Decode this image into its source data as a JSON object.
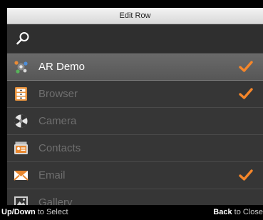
{
  "dialog": {
    "title": "Edit Row"
  },
  "search": {
    "icon": "search-icon"
  },
  "apps": [
    {
      "label": "AR Demo",
      "icon": "ar-demo-icon",
      "checked": true,
      "selected": true
    },
    {
      "label": "Browser",
      "icon": "browser-icon",
      "checked": true,
      "selected": false
    },
    {
      "label": "Camera",
      "icon": "camera-icon",
      "checked": false,
      "selected": false
    },
    {
      "label": "Contacts",
      "icon": "contacts-icon",
      "checked": false,
      "selected": false
    },
    {
      "label": "Email",
      "icon": "email-icon",
      "checked": true,
      "selected": false
    },
    {
      "label": "Gallery",
      "icon": "gallery-icon",
      "checked": false,
      "selected": false
    }
  ],
  "footer": {
    "select_key": "Up/Down",
    "select_text": " to Select",
    "close_key": "Back",
    "close_text": " to Close"
  },
  "colors": {
    "check": "#f5862a",
    "selected_row": "#606060",
    "row": "#363636"
  }
}
